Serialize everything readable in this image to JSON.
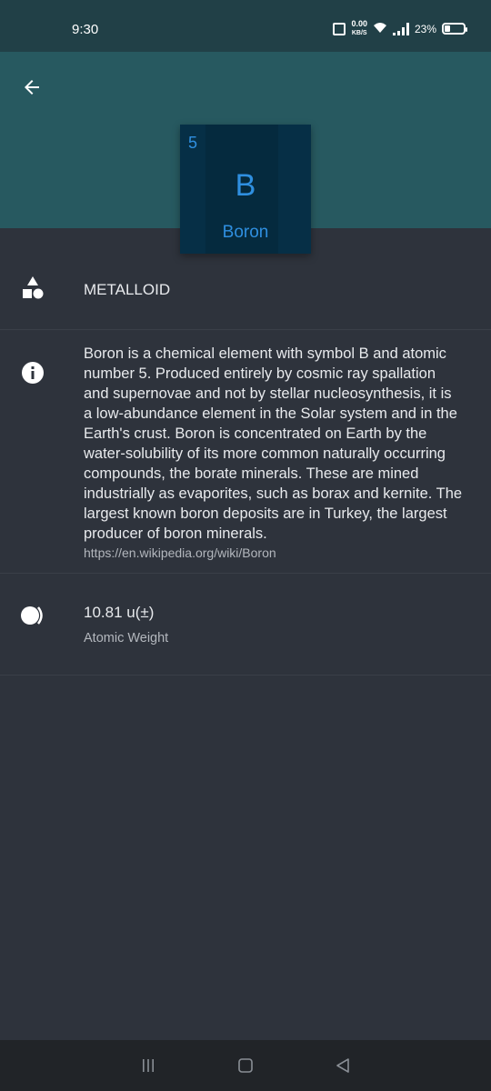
{
  "status": {
    "time": "9:30",
    "speed_value": "0.00",
    "speed_unit": "KB/S",
    "battery": "23%"
  },
  "header": {
    "back_icon": "arrow-left-icon"
  },
  "element": {
    "number": "5",
    "symbol": "B",
    "name": "Boron",
    "tile_color": "#062f46",
    "accent_color": "#2f8fe0"
  },
  "category": {
    "icon": "shapes-icon",
    "label": "METALLOID"
  },
  "description": {
    "icon": "info-icon",
    "text": "Boron is a chemical element with symbol B and atomic number 5. Produced entirely by cosmic ray spallation and supernovae and not by stellar nucleosynthesis, it is a low-abundance element in the Solar system and in the Earth's crust. Boron is concentrated on Earth by the water-solubility of its more common naturally occurring compounds, the borate minerals. These are mined industrially as evaporites, such as borax and kernite. The largest known boron deposits are in Turkey, the largest producer of boron minerals.",
    "source": "https://en.wikipedia.org/wiki/Boron"
  },
  "weight": {
    "icon": "weight-icon",
    "value": "10.81 u(±)",
    "label": "Atomic Weight"
  },
  "colors": {
    "status_bar": "#214047",
    "app_bar": "#275960",
    "background": "#2e333c",
    "nav_bar": "#212428"
  }
}
